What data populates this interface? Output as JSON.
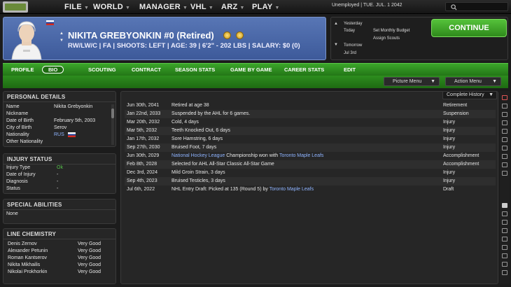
{
  "topbar": {
    "menus": [
      {
        "label": "FILE"
      },
      {
        "label": "WORLD"
      },
      {
        "label": "MANAGER"
      },
      {
        "label": "VHL"
      },
      {
        "label": "ARZ"
      },
      {
        "label": "PLAY"
      }
    ],
    "status": "Unemployed | TUE. JUL. 1 2042",
    "search_icon": "search-icon"
  },
  "player": {
    "name": "NIKITA GREBYONKIN #0 (Retired)",
    "info": "RW/LW/C | FA | SHOOTS: LEFT | AGE: 39 | 6'2\" - 202 LBS | SALARY: $0 (0)",
    "country_flag": "russia-flag"
  },
  "calendar": {
    "yesterday_label": "Yesterday",
    "today_label": "Today",
    "tomorrow_label": "Tomorrow",
    "date_label": "Jul 3rd",
    "task1": "Set Monthly Budget",
    "task2": "Assign Scouts",
    "continue_label": "CONTINUE"
  },
  "tabs": [
    {
      "label": "PROFILE"
    },
    {
      "label": "BIO"
    },
    {
      "label": "SCOUTING"
    },
    {
      "label": "CONTRACT"
    },
    {
      "label": "SEASON STATS"
    },
    {
      "label": "GAME BY GAME"
    },
    {
      "label": "CAREER STATS"
    },
    {
      "label": "EDIT"
    }
  ],
  "active_tab": "BIO",
  "menus": {
    "picture_menu": "Picture Menu",
    "action_menu": "Action Menu"
  },
  "personal": {
    "title": "PERSONAL DETAILS",
    "rows": [
      {
        "label": "Name",
        "value": "Nikita Grebyonkin"
      },
      {
        "label": "Nickname",
        "value": ""
      },
      {
        "label": "Date of Birth",
        "value": "February 5th, 2003"
      },
      {
        "label": "City of Birth",
        "value": "Serov"
      },
      {
        "label": "Nationality",
        "value": "RUS"
      },
      {
        "label": "Other Nationality",
        "value": ""
      }
    ]
  },
  "injury": {
    "title": "INJURY STATUS",
    "rows": [
      {
        "label": "Injury Type",
        "value": "Ok"
      },
      {
        "label": "Date of Injury",
        "value": "-"
      },
      {
        "label": "Diagnosis",
        "value": "-"
      },
      {
        "label": "Status",
        "value": "-"
      }
    ]
  },
  "special": {
    "title": "SPECIAL ABILITIES",
    "value": "None"
  },
  "chemistry": {
    "title": "LINE CHEMISTRY",
    "rows": [
      {
        "name": "Denis Zernov",
        "value": "Very Good"
      },
      {
        "name": "Alexander Petunin",
        "value": "Very Good"
      },
      {
        "name": "Roman Kantserov",
        "value": "Very Good"
      },
      {
        "name": "Nikita Mikhailis",
        "value": "Very Good"
      },
      {
        "name": "Nikolai Prokhorkin",
        "value": "Very Good"
      }
    ]
  },
  "history": {
    "filter": "Complete History",
    "events": [
      {
        "date": "Jun 30th, 2041",
        "pre": "Retired at age 38",
        "link1": "",
        "mid": "",
        "link2": "",
        "type": "Retirement"
      },
      {
        "date": "Jan 22nd, 2033",
        "pre": "Suspended by the AHL for 6 games.",
        "link1": "",
        "mid": "",
        "link2": "",
        "type": "Suspension"
      },
      {
        "date": "Mar 20th, 2032",
        "pre": "Cold, 4 days",
        "link1": "",
        "mid": "",
        "link2": "",
        "type": "Injury"
      },
      {
        "date": "Mar 5th, 2032",
        "pre": "Teeth Knocked Out, 6 days",
        "link1": "",
        "mid": "",
        "link2": "",
        "type": "Injury"
      },
      {
        "date": "Jan 17th, 2032",
        "pre": "Sore Hamstring, 6 days",
        "link1": "",
        "mid": "",
        "link2": "",
        "type": "Injury"
      },
      {
        "date": "Sep 27th, 2030",
        "pre": "Bruised Foot, 7 days",
        "link1": "",
        "mid": "",
        "link2": "",
        "type": "Injury"
      },
      {
        "date": "Jun 30th, 2029",
        "pre": "",
        "link1": "National Hockey League",
        "mid": " Championship won with ",
        "link2": "Toronto Maple Leafs",
        "type": "Accomplishment"
      },
      {
        "date": "Feb 8th, 2028",
        "pre": "Selected for AHL All-Star Classic All-Star Game",
        "link1": "",
        "mid": "",
        "link2": "",
        "type": "Accomplishment"
      },
      {
        "date": "Dec 3rd, 2024",
        "pre": "Mild Groin Strain, 3 days",
        "link1": "",
        "mid": "",
        "link2": "",
        "type": "Injury"
      },
      {
        "date": "Sep 4th, 2023",
        "pre": "Bruised Testicles, 3 days",
        "link1": "",
        "mid": "",
        "link2": "",
        "type": "Injury"
      },
      {
        "date": "Jul 6th, 2022",
        "pre": "NHL Entry Draft: Picked at 135 (Round 5) by ",
        "link1": "",
        "mid": "",
        "link2": "Toronto Maple Leafs",
        "type": "Draft"
      }
    ]
  }
}
